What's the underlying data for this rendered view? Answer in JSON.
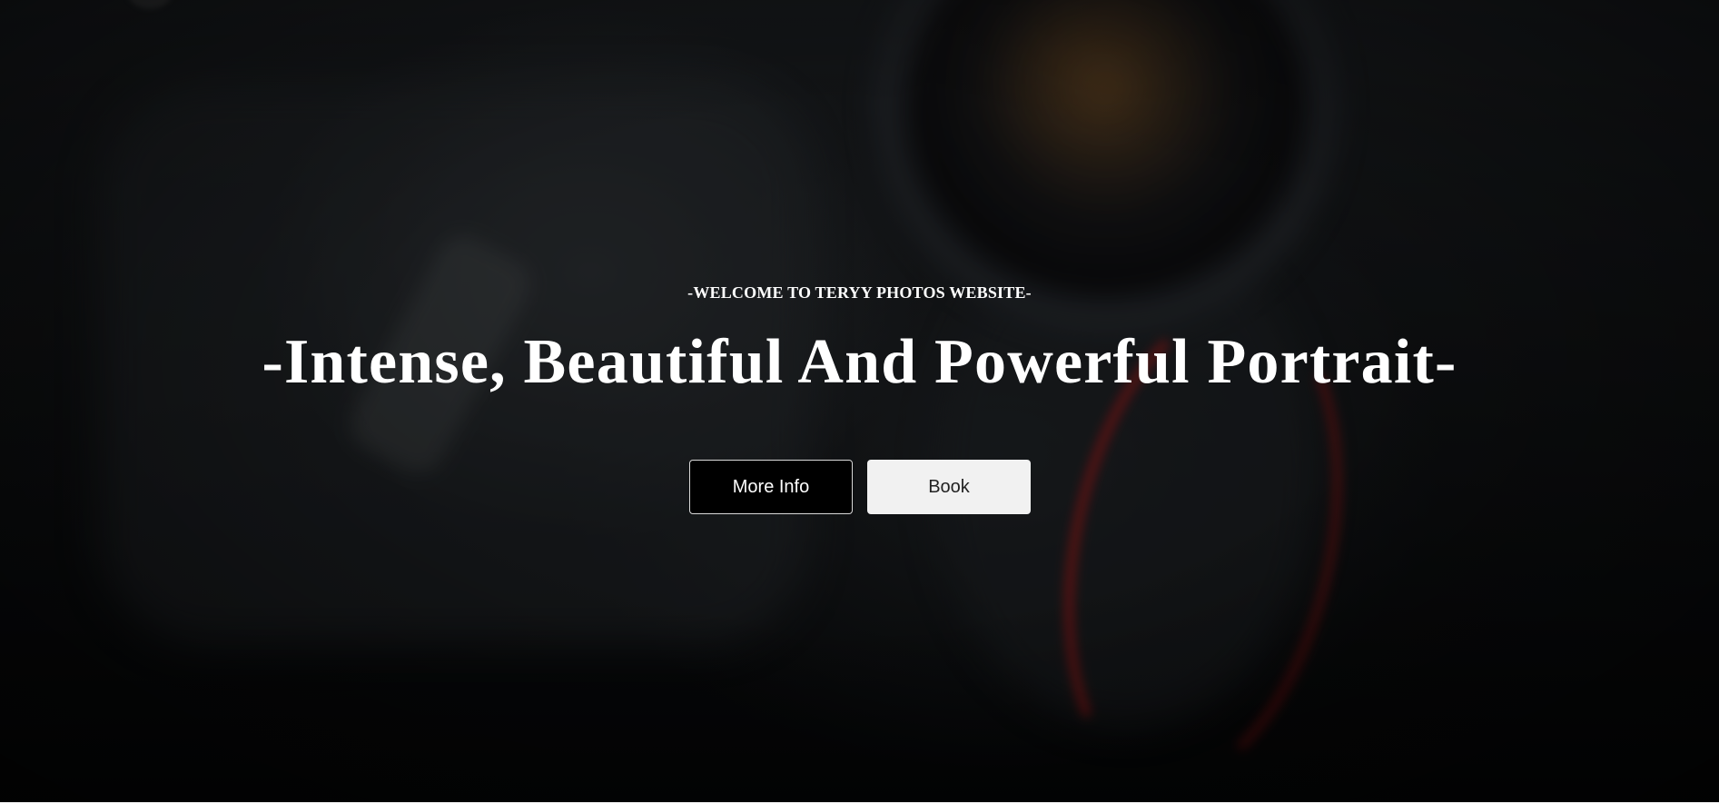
{
  "hero": {
    "welcome_text": "-WELCOME TO TERYY PHOTOS WEBSITE-",
    "headline": "-Intense, Beautiful And Powerful Portrait-",
    "background_image": "blurred-camera-photo"
  },
  "actions": {
    "more_info_label": "More Info",
    "book_label": "Book"
  },
  "colors": {
    "text": "#ffffff",
    "more_info_bg": "#000000",
    "more_info_border": "#d9d9d9",
    "book_bg": "#f1f1f1",
    "book_text": "#222222"
  }
}
